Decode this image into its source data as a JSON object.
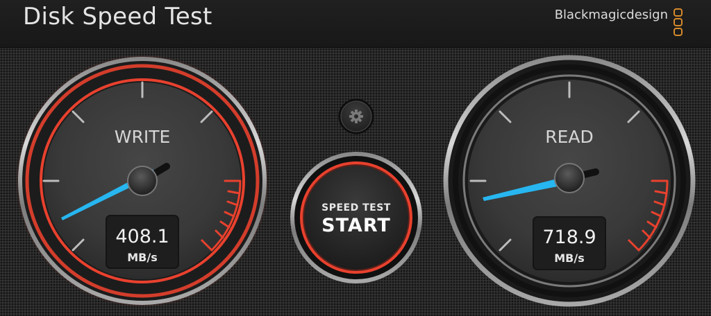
{
  "app": {
    "title": "Disk Speed Test",
    "brand": "Blackmagicdesign"
  },
  "settings": {
    "icon": "gear-icon"
  },
  "write_gauge": {
    "title": "WRITE",
    "value": "408.1",
    "unit": "MB/s",
    "accent_color": "#e8412e"
  },
  "read_gauge": {
    "title": "READ",
    "value": "718.9",
    "unit": "MB/s",
    "accent_color": "#9a9a9a"
  },
  "start_button": {
    "line1": "SPEED TEST",
    "line2": "START",
    "accent_color": "#e8412e"
  },
  "colors": {
    "needle": "#27b6f0",
    "redline": "#e8412e",
    "logo": "#d68a2c"
  }
}
